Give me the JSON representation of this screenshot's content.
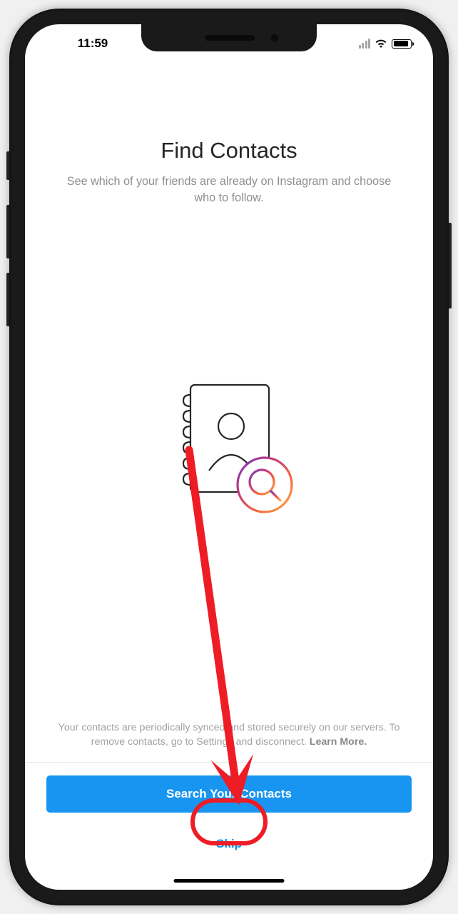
{
  "status_bar": {
    "time": "11:59"
  },
  "header": {
    "title": "Find Contacts",
    "subtitle": "See which of your friends are already on Instagram and choose who to follow."
  },
  "footer": {
    "fine_print_1": "Your contacts are periodically synced and stored securely on our servers. To remove contacts, go to Settings and disconnect. ",
    "learn_more": "Learn More.",
    "primary_button": "Search Your Contacts",
    "skip_button": "Skip"
  }
}
